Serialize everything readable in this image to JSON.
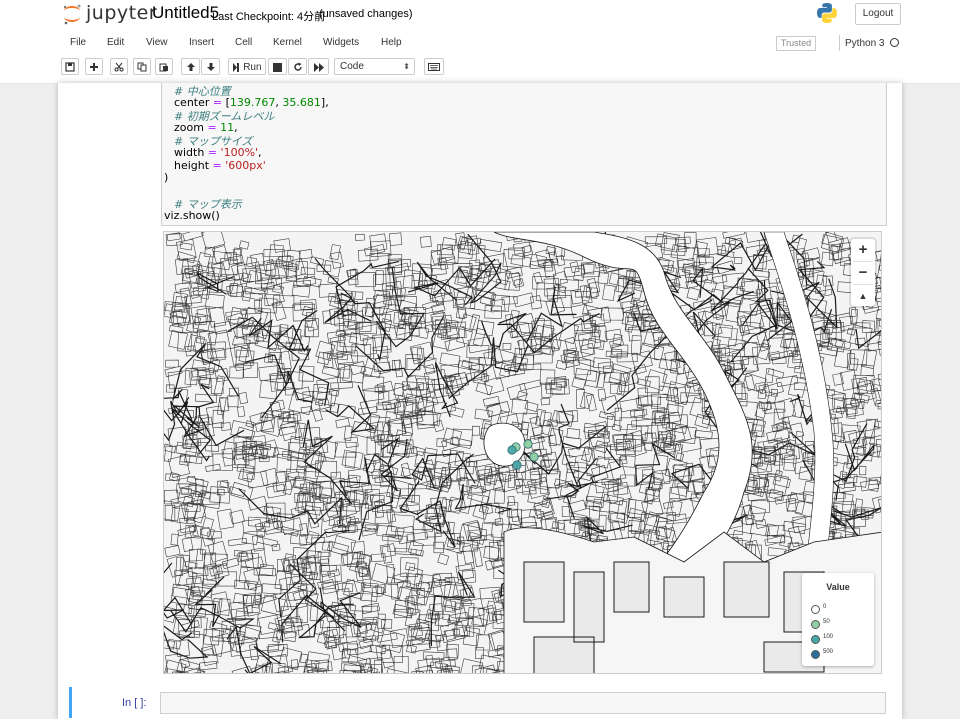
{
  "header": {
    "logo_text": "jupyter",
    "notebook_name": "Untitled5",
    "checkpoint": "Last Checkpoint: 4分前",
    "save_status": "(unsaved changes)",
    "logout_label": "Logout"
  },
  "menubar": {
    "items": [
      "File",
      "Edit",
      "View",
      "Insert",
      "Cell",
      "Kernel",
      "Widgets",
      "Help"
    ],
    "trusted_label": "Trusted",
    "kernel_name": "Python 3"
  },
  "toolbar": {
    "buttons": [
      "save-icon",
      "plus-icon",
      "cut-icon",
      "copy-icon",
      "paste-icon",
      "arrow-up-icon",
      "arrow-down-icon",
      "run-icon",
      "stop-icon",
      "restart-icon",
      "fast-forward-icon",
      "keyboard-icon"
    ],
    "run_label": "Run",
    "cell_type": "Code"
  },
  "code_cell": {
    "lines": [
      {
        "comment": "# 中心位置"
      },
      {
        "var": "center",
        "op": " = ",
        "pre": "[",
        "num1": "139.767",
        "sep": ", ",
        "num2": "35.681",
        "post": "],"
      },
      {
        "comment": "# 初期ズームレベル"
      },
      {
        "var": "zoom",
        "op": " = ",
        "num1": "11",
        "post": ","
      },
      {
        "comment": "# マップサイズ"
      },
      {
        "var": "width",
        "op": " = ",
        "str": "'100%'",
        "post": ","
      },
      {
        "var": "height",
        "op": " = ",
        "str": "'600px'"
      },
      {
        "plain": ")"
      },
      {
        "plain": ""
      },
      {
        "comment": "# マップ表示"
      },
      {
        "plain": "viz.show()"
      }
    ]
  },
  "map": {
    "zoom_in_label": "+",
    "zoom_out_label": "−",
    "compass_label": "▲",
    "background_color": "#fafafa",
    "road_color": "#1a1a1a",
    "water_color": "#ffffff",
    "legend": {
      "title": "Value",
      "entries": [
        {
          "label": "0",
          "color": "#ffffff"
        },
        {
          "label": "50",
          "color": "#8fd1a5"
        },
        {
          "label": "100",
          "color": "#47a6a8"
        },
        {
          "label": "500",
          "color": "#2a6f9e"
        }
      ]
    }
  },
  "next_cell": {
    "prompt": "In [ ]:"
  }
}
